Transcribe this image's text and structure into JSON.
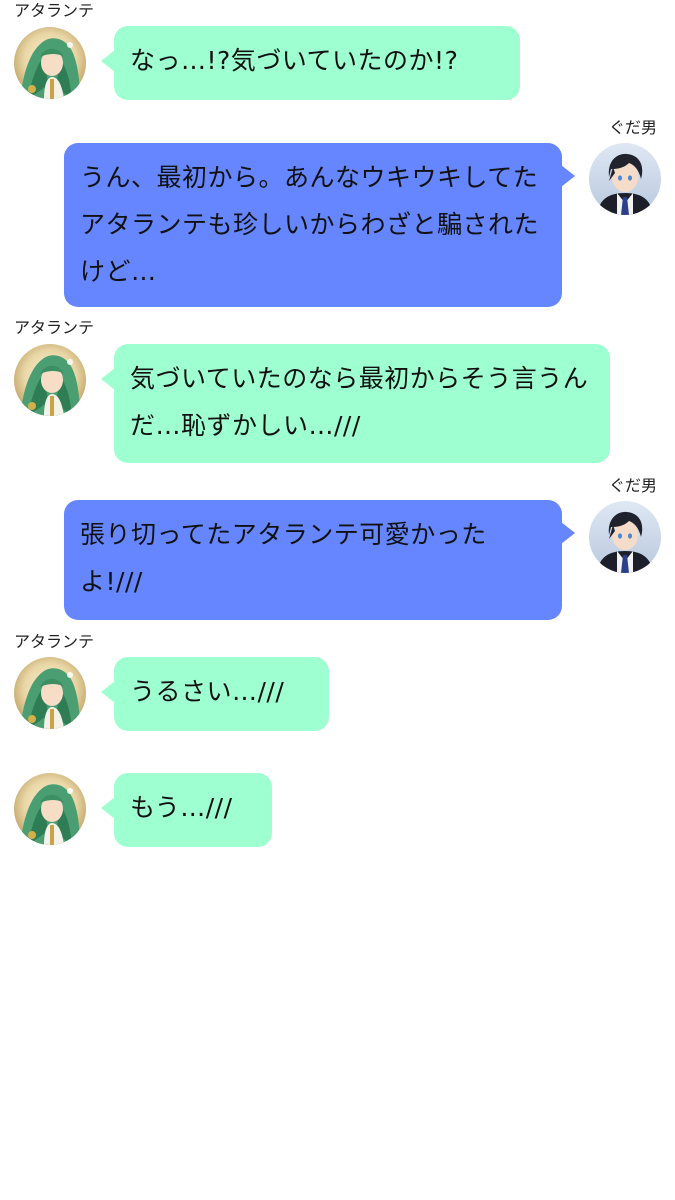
{
  "chat": {
    "messages": [
      {
        "sender": "アタランテ",
        "side": "left",
        "text": "なっ…!?気づいていたのか!?"
      },
      {
        "sender": "ぐだ男",
        "side": "right",
        "text": "うん、最初から。あんなウキウキしてたアタランテも珍しいからわざと騙されたけど…"
      },
      {
        "sender": "アタランテ",
        "side": "left",
        "text": "気づいていたのなら最初からそう言うんだ…恥ずかしい…///"
      },
      {
        "sender": "ぐだ男",
        "side": "right",
        "text": "張り切ってたアタランテ可愛かったよ!///"
      },
      {
        "sender": "アタランテ",
        "side": "left",
        "text": "うるさい…///"
      },
      {
        "sender": "",
        "side": "left",
        "text": "もう…///"
      }
    ]
  },
  "colors": {
    "left_bubble": "#9effd0",
    "right_bubble": "#6586fe",
    "background": "#ffffff"
  },
  "icons": {
    "atalante_avatar": "atalante-avatar-icon",
    "gudao_avatar": "gudao-avatar-icon"
  }
}
